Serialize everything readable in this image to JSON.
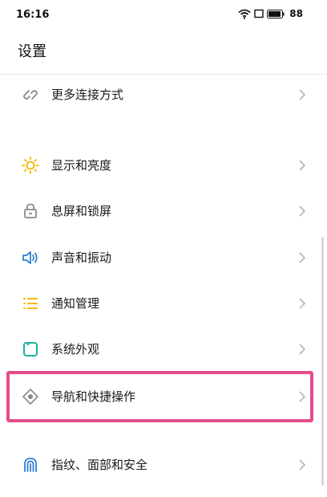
{
  "status_bar": {
    "time": "16:16",
    "battery": "88"
  },
  "page": {
    "title": "设置"
  },
  "settings": {
    "more_connection": "更多连接方式",
    "display_brightness": "显示和亮度",
    "lock_screen": "息屏和锁屏",
    "sound_vibration": "声音和振动",
    "notification_management": "通知管理",
    "system_appearance": "系统外观",
    "navigation_shortcuts": "导航和快捷操作",
    "fingerprint_face_security": "指纹、面部和安全"
  },
  "colors": {
    "highlight": "#e34d8c",
    "yellow": "#f5b800",
    "teal": "#18b39b",
    "blue": "#2f7fd6",
    "gray": "#8a8a8a"
  }
}
